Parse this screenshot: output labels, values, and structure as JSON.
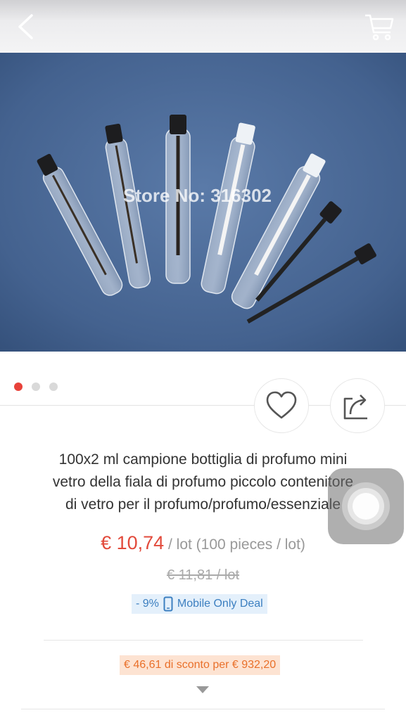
{
  "header": {
    "back_icon": "chevron-left-icon",
    "cart_icon": "shopping-cart-icon"
  },
  "gallery": {
    "watermark": "Store No: 316302",
    "image_count": 3,
    "active_index": 0
  },
  "actions": {
    "wishlist_icon": "heart-icon",
    "share_icon": "share-icon"
  },
  "product": {
    "title_line1": "100x2 ml campione bottiglia di profumo mini",
    "title_line2": "vetro della fiala di profumo piccolo contenitore",
    "title_line3": "di vetro per il profumo/profumo/essenziale",
    "price": "€ 10,74",
    "price_unit": " / lot (100 pieces / lot)",
    "old_price": "€ 11,81  / lot",
    "deal_percent": "- 9%",
    "deal_label": "Mobile Only Deal",
    "coupon": "€ 46,61 di sconto per € 932,20"
  },
  "colors": {
    "price": "#e24a3b",
    "deal_bg": "#e4f0fb",
    "coupon_bg": "#fde3d2",
    "coupon_text": "#e9702a",
    "active_dot": "#e8423a"
  }
}
